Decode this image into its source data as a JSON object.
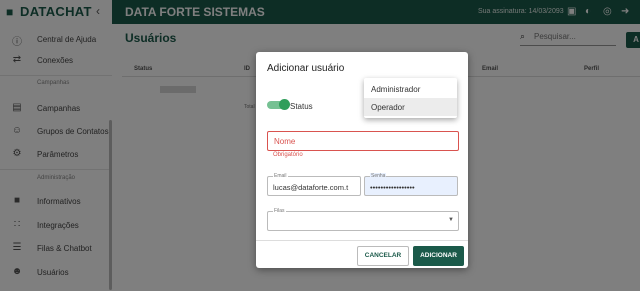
{
  "brand": {
    "logo_icon": "chat-bubble-icon",
    "name": "DATACHAT"
  },
  "topbar": {
    "company": "DATA FORTE SISTEMAS",
    "subscription": "Sua assinatura: 14/03/2093",
    "color": "#1b5a4a"
  },
  "sidebar": {
    "items": [
      {
        "icon": "help-icon",
        "label": "Central de Ajuda"
      },
      {
        "icon": "connections-icon",
        "label": "Conexões"
      },
      {
        "section": "Campanhas"
      },
      {
        "icon": "campaign-icon",
        "label": "Campanhas"
      },
      {
        "icon": "group-icon",
        "label": "Grupos de Contatos"
      },
      {
        "icon": "settings-icon",
        "label": "Parâmetros"
      },
      {
        "section": "Administração"
      },
      {
        "icon": "info-icon",
        "label": "Informativos"
      },
      {
        "icon": "integration-icon",
        "label": "Integrações"
      },
      {
        "icon": "queue-icon",
        "label": "Filas & Chatbot"
      },
      {
        "icon": "users-icon",
        "label": "Usuários"
      }
    ]
  },
  "main": {
    "title": "Usuários",
    "search_placeholder": "Pesquisar...",
    "add_label": "A",
    "columns": [
      "Status",
      "ID",
      "Email",
      "Perfil"
    ],
    "footer": "Total"
  },
  "dialog": {
    "title": "Adicionar usuário",
    "status_label": "Status",
    "status_on": true,
    "name_placeholder": "Nome",
    "name_error": "Obrigatório",
    "email_label": "Email",
    "email_value": "lucas@dataforte.com.t",
    "password_label": "Senha",
    "password_value": "•••••••••••••••••",
    "queues_label": "Filas",
    "cancel_label": "CANCELAR",
    "add_label": "ADICIONAR",
    "accent": "#1b5a4a",
    "error_color": "#d9534f"
  },
  "profile_menu": {
    "options": [
      "Administrador",
      "Operador"
    ],
    "selected": "Operador"
  }
}
